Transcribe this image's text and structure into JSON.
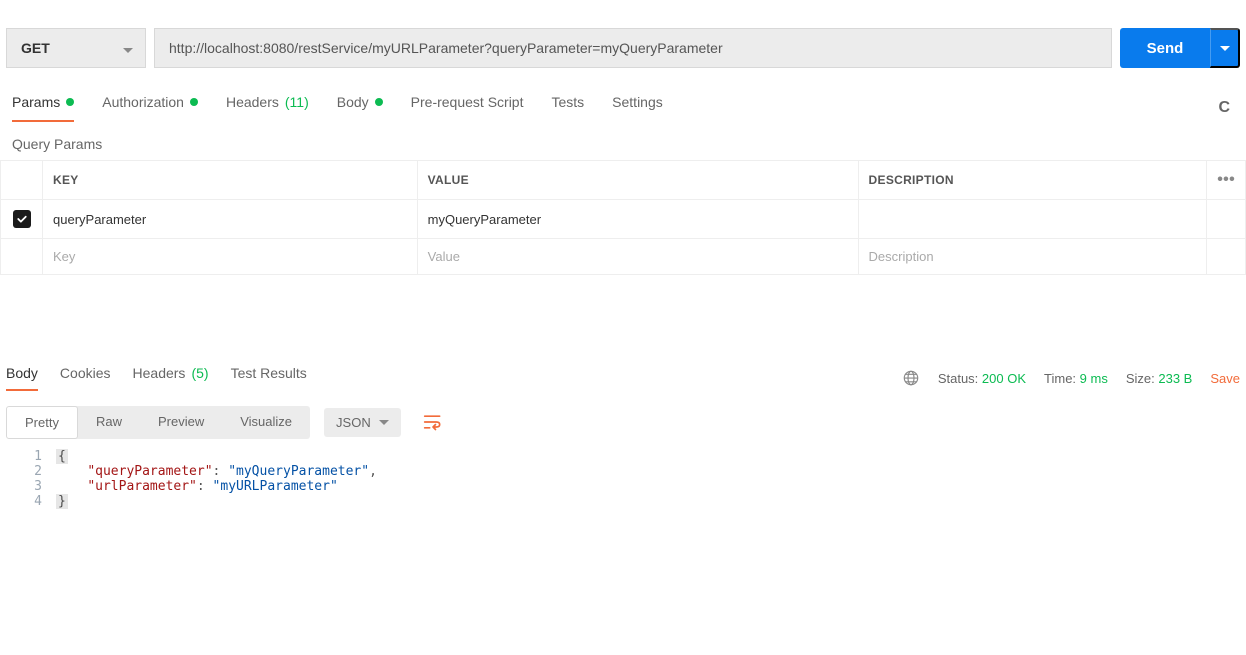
{
  "request": {
    "method": "GET",
    "url": "http://localhost:8080/restService/myURLParameter?queryParameter=myQueryParameter",
    "send_label": "Send"
  },
  "tabs": {
    "params": "Params",
    "authorization": "Authorization",
    "headers": "Headers",
    "headers_count": "(11)",
    "body": "Body",
    "prerequest": "Pre-request Script",
    "tests": "Tests",
    "settings": "Settings"
  },
  "section_label": "Query Params",
  "param_headers": {
    "key": "KEY",
    "value": "VALUE",
    "description": "DESCRIPTION"
  },
  "param_rows": [
    {
      "enabled": true,
      "key": "queryParameter",
      "value": "myQueryParameter",
      "description": ""
    }
  ],
  "param_placeholders": {
    "key": "Key",
    "value": "Value",
    "description": "Description"
  },
  "more_dots": "•••",
  "response_tabs": {
    "body": "Body",
    "cookies": "Cookies",
    "headers": "Headers",
    "headers_count": "(5)",
    "test_results": "Test Results"
  },
  "response_meta": {
    "status_label": "Status:",
    "status_value": "200 OK",
    "time_label": "Time:",
    "time_value": "9 ms",
    "size_label": "Size:",
    "size_value": "233 B",
    "save_label": "Save"
  },
  "view_options": {
    "pretty": "Pretty",
    "raw": "Raw",
    "preview": "Preview",
    "visualize": "Visualize",
    "format": "JSON"
  },
  "code": {
    "l1": "{",
    "l2_indent": "    ",
    "l2_key": "\"queryParameter\"",
    "l2_colon": ": ",
    "l2_val": "\"myQueryParameter\"",
    "l2_comma": ",",
    "l3_indent": "    ",
    "l3_key": "\"urlParameter\"",
    "l3_colon": ": ",
    "l3_val": "\"myURLParameter\"",
    "l4": "}",
    "n1": "1",
    "n2": "2",
    "n3": "3",
    "n4": "4"
  }
}
